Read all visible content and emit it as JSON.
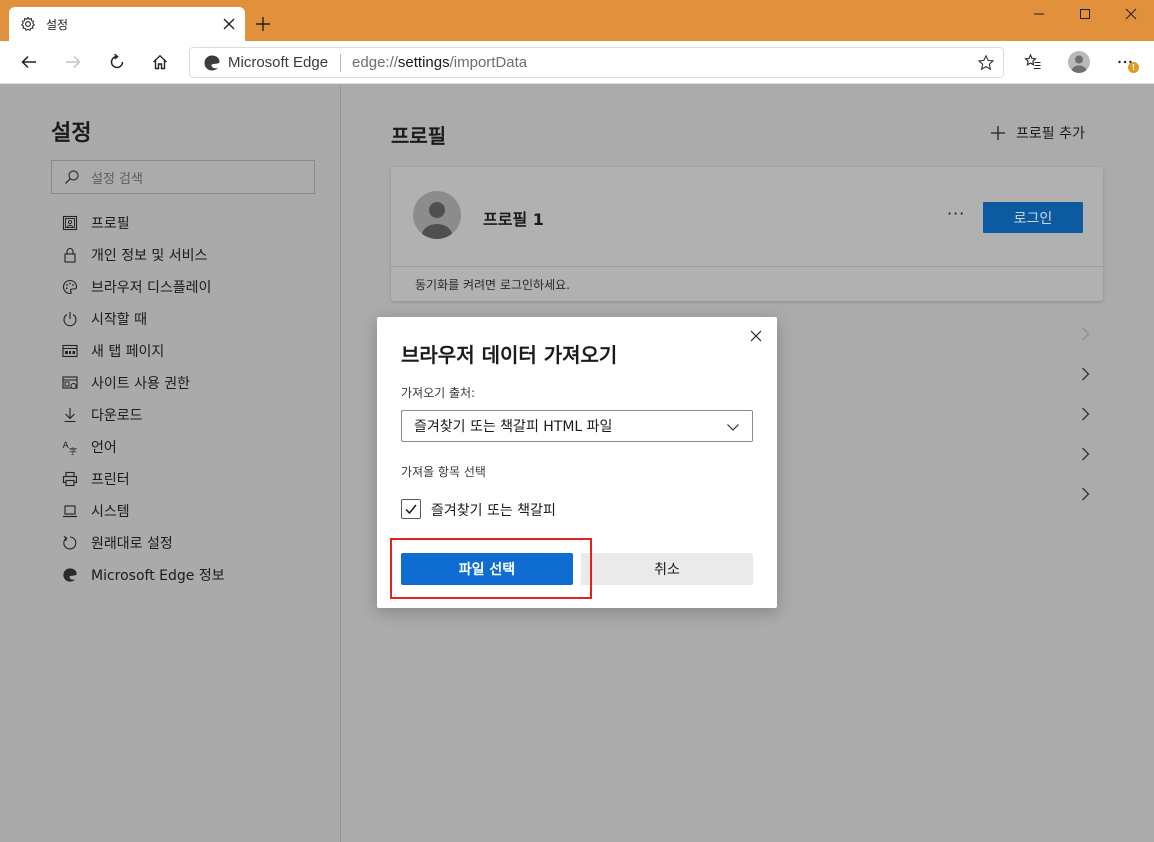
{
  "browser": {
    "tab_title": "설정",
    "address_site": "Microsoft Edge",
    "address_url_prefix": "edge://",
    "address_url_path": "settings",
    "address_url_suffix": "/importData",
    "notification_badge": "!"
  },
  "sidebar": {
    "title": "설정",
    "search_placeholder": "설정 검색",
    "items": [
      {
        "label": "프로필",
        "icon": "profile-icon"
      },
      {
        "label": "개인 정보 및 서비스",
        "icon": "lock-icon"
      },
      {
        "label": "브라우저 디스플레이",
        "icon": "palette-icon"
      },
      {
        "label": "시작할 때",
        "icon": "power-icon"
      },
      {
        "label": "새 탭 페이지",
        "icon": "new-tab-page-icon"
      },
      {
        "label": "사이트 사용 권한",
        "icon": "site-permissions-icon"
      },
      {
        "label": "다운로드",
        "icon": "download-icon"
      },
      {
        "label": "언어",
        "icon": "language-icon"
      },
      {
        "label": "프린터",
        "icon": "printer-icon"
      },
      {
        "label": "시스템",
        "icon": "laptop-icon"
      },
      {
        "label": "원래대로 설정",
        "icon": "reset-icon"
      },
      {
        "label": "Microsoft Edge 정보",
        "icon": "edge-logo-icon"
      }
    ]
  },
  "main": {
    "title": "프로필",
    "add_profile_label": "프로필 추가",
    "profile": {
      "name": "프로필 1",
      "more_label": "···",
      "login_label": "로그인",
      "sync_text": "동기화를 켜려면 로그인하세요."
    }
  },
  "dialog": {
    "title": "브라우저 데이터 가져오기",
    "source_label": "가져오기 출처:",
    "source_value": "즐겨찾기 또는 책갈피 HTML 파일",
    "items_label": "가져올 항목 선택",
    "checkbox_label": "즐겨찾기 또는 책갈피",
    "checkbox_checked": true,
    "primary_button": "파일 선택",
    "cancel_button": "취소"
  },
  "colors": {
    "titlebar": "#e1903b",
    "primary": "#0f6cd0",
    "highlight": "#e32121"
  }
}
